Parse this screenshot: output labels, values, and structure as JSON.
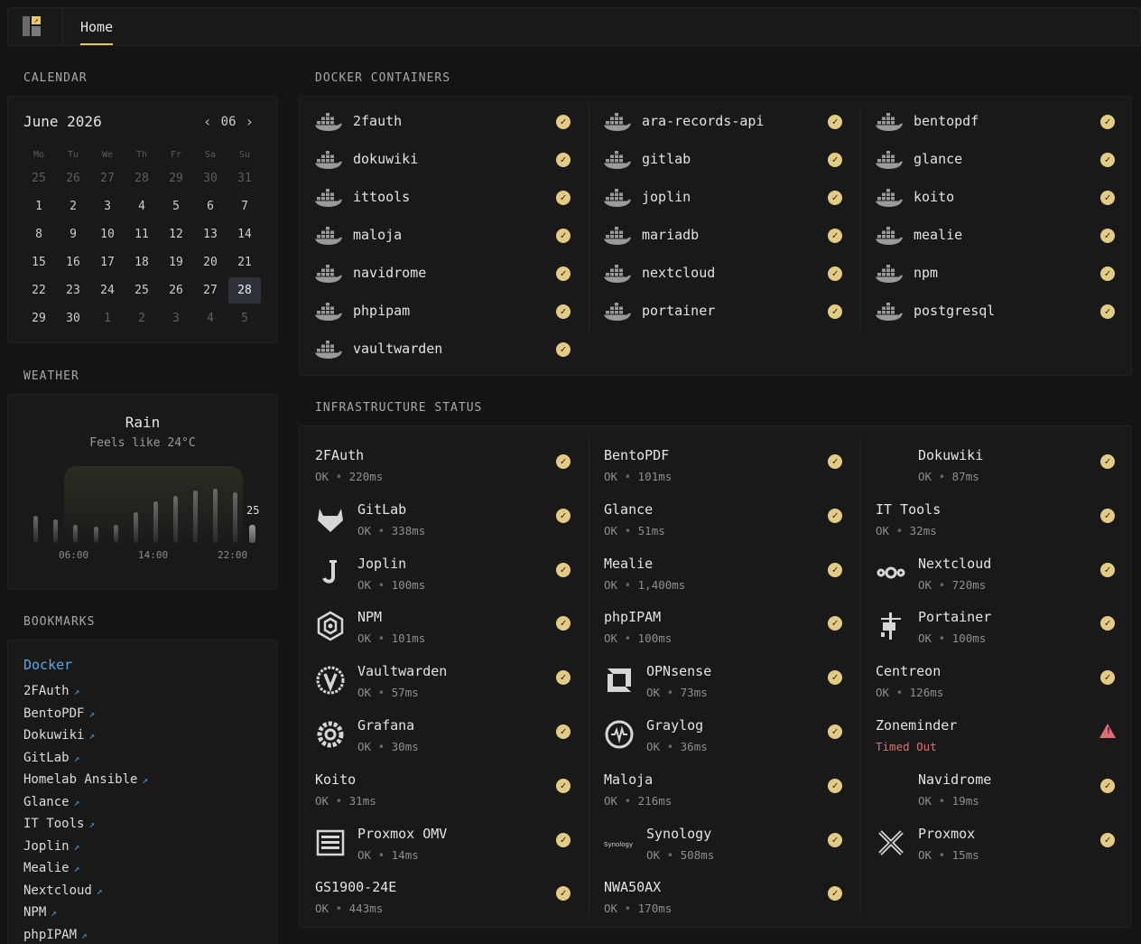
{
  "header": {
    "tab_home": "Home"
  },
  "calendar": {
    "section": "CALENDAR",
    "month": "June 2026",
    "month_num": "06",
    "weekdays": [
      "Mo",
      "Tu",
      "We",
      "Th",
      "Fr",
      "Sa",
      "Su"
    ],
    "weeks": [
      [
        "25",
        "26",
        "27",
        "28",
        "29",
        "30",
        "31"
      ],
      [
        "1",
        "2",
        "3",
        "4",
        "5",
        "6",
        "7"
      ],
      [
        "8",
        "9",
        "10",
        "11",
        "12",
        "13",
        "14"
      ],
      [
        "15",
        "16",
        "17",
        "18",
        "19",
        "20",
        "21"
      ],
      [
        "22",
        "23",
        "24",
        "25",
        "26",
        "27",
        "28"
      ],
      [
        "29",
        "30",
        "1",
        "2",
        "3",
        "4",
        "5"
      ]
    ],
    "today": "28"
  },
  "weather": {
    "section": "WEATHER",
    "condition": "Rain",
    "feels_like": "Feels like 24°C",
    "current_temp": "25",
    "time_labels": [
      "06:00",
      "14:00",
      "22:00"
    ]
  },
  "bookmarks": {
    "section": "BOOKMARKS",
    "group": "Docker",
    "items": [
      "2FAuth",
      "BentoPDF",
      "Dokuwiki",
      "GitLab",
      "Homelab Ansible",
      "Glance",
      "IT Tools",
      "Joplin",
      "Mealie",
      "Nextcloud",
      "NPM",
      "phpIPAM"
    ]
  },
  "docker": {
    "section": "DOCKER CONTAINERS",
    "containers": [
      "2fauth",
      "ara-records-api",
      "bentopdf",
      "dokuwiki",
      "gitlab",
      "glance",
      "ittools",
      "joplin",
      "koito",
      "maloja",
      "mariadb",
      "mealie",
      "navidrome",
      "nextcloud",
      "npm",
      "phpipam",
      "portainer",
      "postgresql",
      "vaultwarden"
    ]
  },
  "infra": {
    "section": "INFRASTRUCTURE STATUS",
    "services": [
      {
        "name": "2FAuth",
        "status": "OK",
        "time": "220ms",
        "icon": ""
      },
      {
        "name": "BentoPDF",
        "status": "OK",
        "time": "101ms",
        "icon": ""
      },
      {
        "name": "Dokuwiki",
        "status": "OK",
        "time": "87ms",
        "icon": "blank"
      },
      {
        "name": "GitLab",
        "status": "OK",
        "time": "338ms",
        "icon": "gitlab-icon"
      },
      {
        "name": "Glance",
        "status": "OK",
        "time": "51ms",
        "icon": ""
      },
      {
        "name": "IT Tools",
        "status": "OK",
        "time": "32ms",
        "icon": ""
      },
      {
        "name": "Joplin",
        "status": "OK",
        "time": "100ms",
        "icon": "joplin-icon"
      },
      {
        "name": "Mealie",
        "status": "OK",
        "time": "1,400ms",
        "icon": ""
      },
      {
        "name": "Nextcloud",
        "status": "OK",
        "time": "720ms",
        "icon": "nextcloud-icon"
      },
      {
        "name": "NPM",
        "status": "OK",
        "time": "101ms",
        "icon": "npm-icon"
      },
      {
        "name": "phpIPAM",
        "status": "OK",
        "time": "100ms",
        "icon": ""
      },
      {
        "name": "Portainer",
        "status": "OK",
        "time": "100ms",
        "icon": "portainer-icon"
      },
      {
        "name": "Vaultwarden",
        "status": "OK",
        "time": "57ms",
        "icon": "vaultwarden-icon"
      },
      {
        "name": "OPNsense",
        "status": "OK",
        "time": "73ms",
        "icon": "opnsense-icon"
      },
      {
        "name": "Centreon",
        "status": "OK",
        "time": "126ms",
        "icon": ""
      },
      {
        "name": "Grafana",
        "status": "OK",
        "time": "30ms",
        "icon": "grafana-icon"
      },
      {
        "name": "Graylog",
        "status": "OK",
        "time": "36ms",
        "icon": "graylog-icon"
      },
      {
        "name": "Zoneminder",
        "status": "Timed Out",
        "time": "",
        "icon": "",
        "error": true
      },
      {
        "name": "Koito",
        "status": "OK",
        "time": "31ms",
        "icon": ""
      },
      {
        "name": "Maloja",
        "status": "OK",
        "time": "216ms",
        "icon": ""
      },
      {
        "name": "Navidrome",
        "status": "OK",
        "time": "19ms",
        "icon": "blank"
      },
      {
        "name": "Proxmox OMV",
        "status": "OK",
        "time": "14ms",
        "icon": "proxmox-omv-icon"
      },
      {
        "name": "Synology",
        "status": "OK",
        "time": "508ms",
        "icon": "synology-icon"
      },
      {
        "name": "Proxmox",
        "status": "OK",
        "time": "15ms",
        "icon": "proxmox-icon"
      },
      {
        "name": "GS1900-24E",
        "status": "OK",
        "time": "443ms",
        "icon": ""
      },
      {
        "name": "NWA50AX",
        "status": "OK",
        "time": "170ms",
        "icon": ""
      }
    ]
  },
  "colors": {
    "accent": "#e3cb86",
    "link": "#5aa6e6",
    "error": "#e06c75"
  }
}
